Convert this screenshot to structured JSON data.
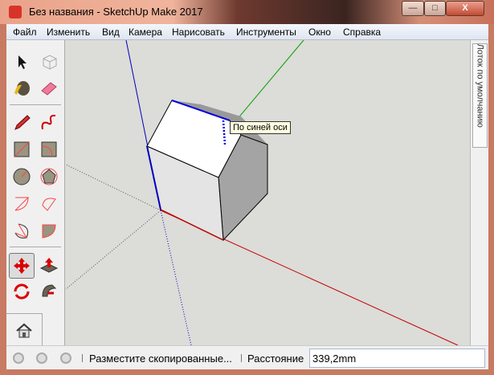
{
  "window": {
    "title": "Без названия - SketchUp Make 2017",
    "minimize": "—",
    "maximize": "□",
    "close": "X"
  },
  "menu": [
    "Файл",
    "Изменить",
    "Вид",
    "Камера",
    "Нарисовать",
    "Инструменты",
    "Окно",
    "Справка"
  ],
  "tools": [
    "select",
    "component",
    "paint-bucket",
    "eraser",
    "pencil",
    "freehand",
    "rectangle",
    "rotated-rectangle",
    "circle",
    "polygon",
    "arc",
    "two-point-arc",
    "three-point-arc",
    "pie",
    "move",
    "push-pull",
    "rotate",
    "follow-me"
  ],
  "tray": {
    "label": "Лоток по умолчанию"
  },
  "viewport": {
    "tooltip": "По синей оси"
  },
  "status": {
    "message": "Разместите скопированные...",
    "measure_label": "Расстояние",
    "measure_value": "339,2mm"
  },
  "colors": {
    "red_axis": "#c00000",
    "green_axis": "#00a000",
    "blue_axis": "#0000c0",
    "accent": "#d8332a"
  }
}
